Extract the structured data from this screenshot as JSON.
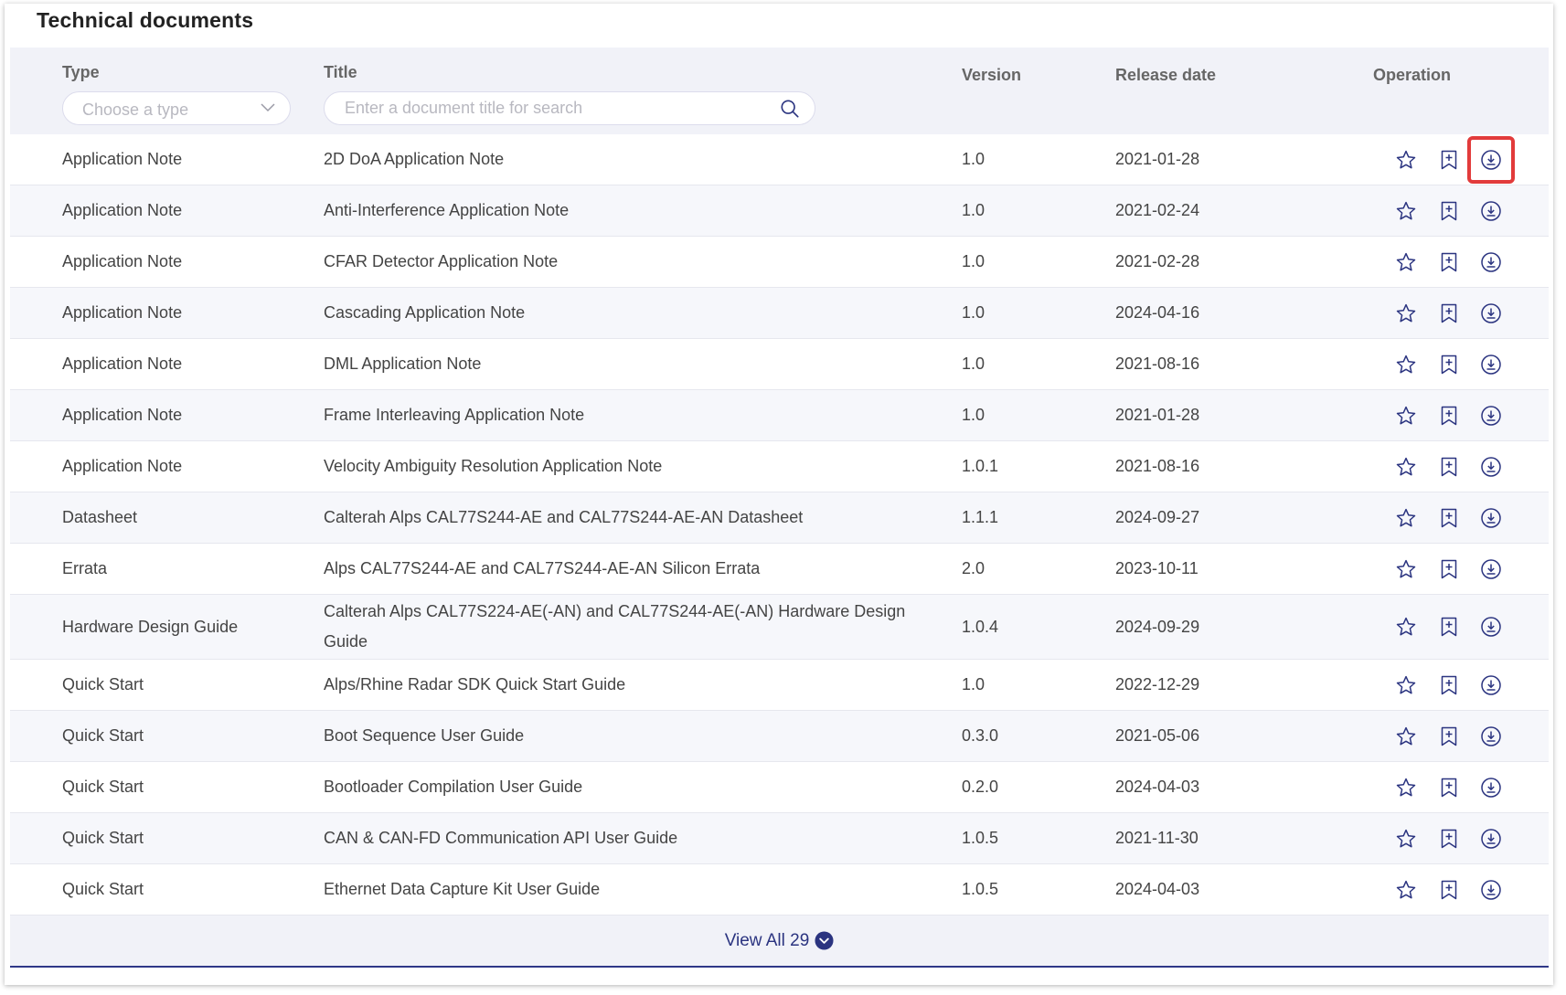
{
  "section_title": "Technical documents",
  "columns": {
    "type": "Type",
    "title": "Title",
    "version": "Version",
    "release_date": "Release date",
    "operation": "Operation"
  },
  "filters": {
    "type_placeholder": "Choose a type",
    "title_placeholder": "Enter a document title for search"
  },
  "rows": [
    {
      "type": "Application Note",
      "title": "2D DoA Application Note",
      "version": "1.0",
      "date": "2021-01-28"
    },
    {
      "type": "Application Note",
      "title": "Anti-Interference Application Note",
      "version": "1.0",
      "date": "2021-02-24"
    },
    {
      "type": "Application Note",
      "title": "CFAR Detector Application Note",
      "version": "1.0",
      "date": "2021-02-28"
    },
    {
      "type": "Application Note",
      "title": "Cascading Application Note",
      "version": "1.0",
      "date": "2024-04-16"
    },
    {
      "type": "Application Note",
      "title": "DML Application Note",
      "version": "1.0",
      "date": "2021-08-16"
    },
    {
      "type": "Application Note",
      "title": "Frame Interleaving Application Note",
      "version": "1.0",
      "date": "2021-01-28"
    },
    {
      "type": "Application Note",
      "title": "Velocity Ambiguity Resolution Application Note",
      "version": "1.0.1",
      "date": "2021-08-16"
    },
    {
      "type": "Datasheet",
      "title": "Calterah Alps CAL77S244-AE and CAL77S244-AE-AN Datasheet",
      "version": "1.1.1",
      "date": "2024-09-27"
    },
    {
      "type": "Errata",
      "title": "Alps CAL77S244-AE and CAL77S244-AE-AN Silicon Errata",
      "version": "2.0",
      "date": "2023-10-11"
    },
    {
      "type": "Hardware Design Guide",
      "title": "Calterah Alps CAL77S224-AE(-AN) and CAL77S244-AE(-AN) Hardware Design Guide",
      "version": "1.0.4",
      "date": "2024-09-29"
    },
    {
      "type": "Quick Start",
      "title": "Alps/Rhine Radar SDK Quick Start Guide",
      "version": "1.0",
      "date": "2022-12-29"
    },
    {
      "type": "Quick Start",
      "title": "Boot Sequence User Guide",
      "version": "0.3.0",
      "date": "2021-05-06"
    },
    {
      "type": "Quick Start",
      "title": "Bootloader Compilation User Guide",
      "version": "0.2.0",
      "date": "2024-04-03"
    },
    {
      "type": "Quick Start",
      "title": "CAN & CAN-FD Communication API User Guide",
      "version": "1.0.5",
      "date": "2021-11-30"
    },
    {
      "type": "Quick Start",
      "title": "Ethernet Data Capture Kit User Guide",
      "version": "1.0.5",
      "date": "2024-04-03"
    }
  ],
  "view_all_label": "View All 29",
  "icons": {
    "star": "star-icon",
    "bookmark": "bookmark-add-icon",
    "download": "download-icon",
    "search": "search-icon",
    "chevron": "chevron-down-icon",
    "view_all": "chevron-down-circle-icon"
  },
  "colors": {
    "accent": "#2b3480",
    "highlight_border": "#e23b3b",
    "header_bg": "#f1f2f8"
  }
}
